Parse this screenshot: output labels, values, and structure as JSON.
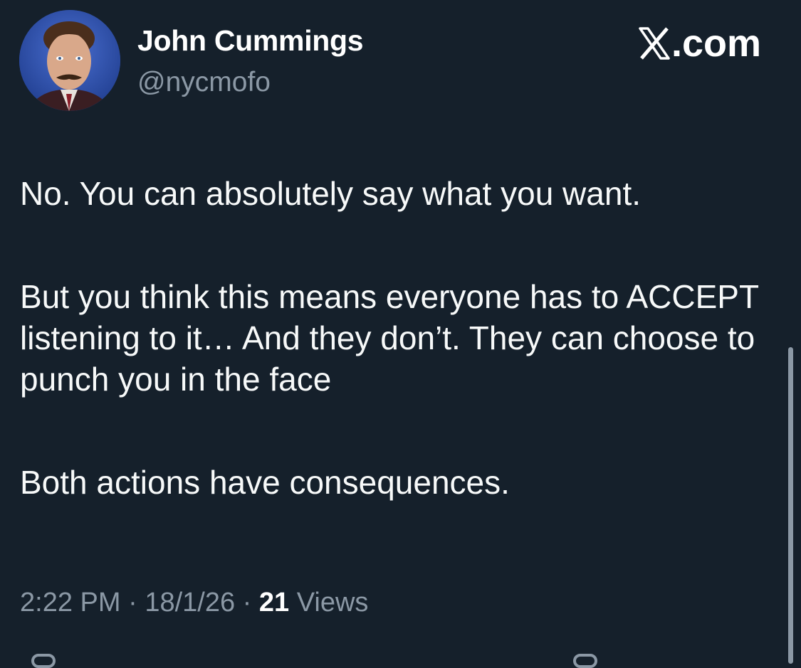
{
  "post": {
    "author_name": "John Cummings",
    "author_handle": "@nycmofo",
    "brand": ".com",
    "brand_icon": "x-logo-icon",
    "text_paragraphs": [
      "No. You can absolutely say what you want.",
      "But you think this means everyone has to ACCEPT listening to it… And they don’t. They can choose to punch you in the face",
      "Both actions have consequences."
    ],
    "time": "2:22 PM",
    "date": "18/1/26",
    "separator": "·",
    "views_count": "21",
    "views_label": "Views"
  },
  "colors": {
    "background": "#15202b",
    "text": "#f7f9f9",
    "secondary_text": "#8b98a5"
  }
}
